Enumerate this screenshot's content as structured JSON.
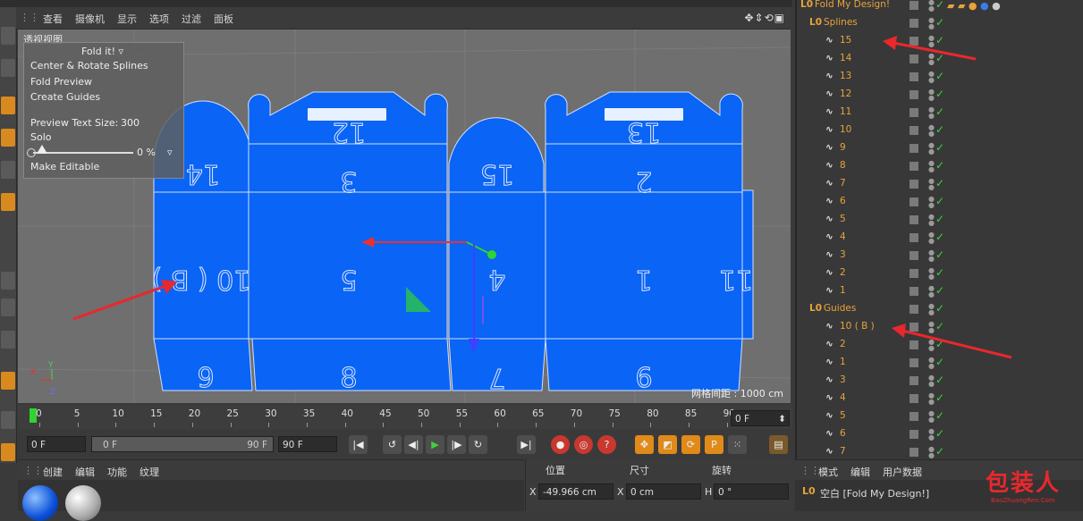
{
  "viewport": {
    "menu": [
      "查看",
      "摄像机",
      "显示",
      "选项",
      "过滤",
      "面板"
    ],
    "camera_label": "透视视图",
    "grid_readout": "网格间距 : 1000 cm",
    "panel_numbers": [
      "15",
      "14",
      "12",
      "3",
      "13",
      "2",
      "10 ( B )",
      "5",
      "4",
      "1",
      "11",
      "9",
      "8",
      "7",
      "6"
    ]
  },
  "fold_panel": {
    "title": "Fold it!",
    "items": [
      "Center & Rotate Splines",
      "Fold Preview",
      "Create Guides"
    ],
    "preview_text_size_label": "Preview Text Size:",
    "preview_text_size_value": "300",
    "solo_label": "Solo",
    "percent": "0 %",
    "slider_value": 0,
    "make_editable": "Make Editable"
  },
  "timeline": {
    "ticks": [
      "0",
      "5",
      "10",
      "15",
      "20",
      "25",
      "30",
      "35",
      "40",
      "45",
      "50",
      "55",
      "60",
      "65",
      "70",
      "75",
      "80",
      "85",
      "90"
    ],
    "current_frame": "0 F"
  },
  "transport": {
    "start": "0 F",
    "range_start": "0 F",
    "range_end": "90 F",
    "end": "90 F"
  },
  "materials": {
    "menu": [
      "创建",
      "编辑",
      "功能",
      "纹理"
    ]
  },
  "coords": {
    "headers": [
      "位置",
      "尺寸",
      "旋转"
    ],
    "x_label": "X",
    "x_pos": "-49.966 cm",
    "x2_label": "X",
    "x_size": "0 cm",
    "h_label": "H",
    "h_rot": "0 °"
  },
  "objects": {
    "root": "Fold My Design!",
    "splines_group": "Splines",
    "splines": [
      "15",
      "14",
      "13",
      "12",
      "11",
      "10",
      "9",
      "8",
      "7",
      "6",
      "5",
      "4",
      "3",
      "2",
      "1"
    ],
    "guides_group": "Guides",
    "guides": [
      "10 ( B )",
      "2",
      "1",
      "3",
      "4",
      "5",
      "6",
      "7"
    ]
  },
  "attributes": {
    "menu": [
      "模式",
      "编辑",
      "用户数据"
    ],
    "object_label": "空白 [Fold My Design!]"
  },
  "watermark": {
    "main": "包装人",
    "sub": "BaoZhuangRen.Com"
  },
  "colors": {
    "dieline": "#0a64f5",
    "accent": "#e8a33a",
    "arrow": "#e8282d",
    "check": "#3cd43c"
  }
}
